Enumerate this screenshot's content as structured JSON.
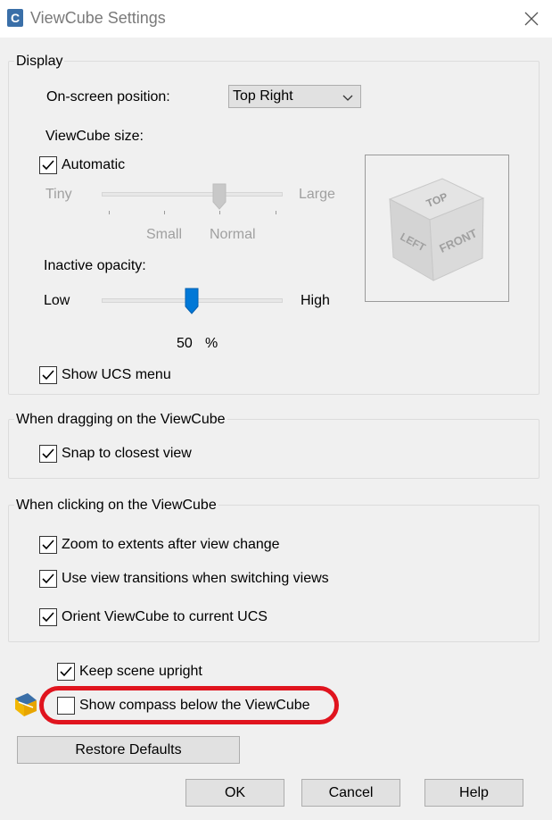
{
  "window": {
    "title": "ViewCube Settings",
    "app_icon": "autocad-icon",
    "close_icon": "close-icon"
  },
  "display": {
    "legend": "Display",
    "position_label": "On-screen position:",
    "position_value": "Top Right",
    "size_label": "ViewCube size:",
    "automatic_label": "Automatic",
    "automatic_checked": true,
    "size_tiny": "Tiny",
    "size_small": "Small",
    "size_normal": "Normal",
    "size_large": "Large",
    "size_selected": "Normal",
    "opacity_label": "Inactive opacity:",
    "opacity_low": "Low",
    "opacity_high": "High",
    "opacity_value": "50",
    "opacity_unit": "%",
    "show_ucs_label": "Show UCS menu",
    "show_ucs_checked": true,
    "cube_faces": {
      "top": "TOP",
      "left": "LEFT",
      "front": "FRONT"
    }
  },
  "dragging": {
    "legend": "When dragging on the ViewCube",
    "snap_label": "Snap to closest view",
    "snap_checked": true
  },
  "clicking": {
    "legend": "When clicking on the ViewCube",
    "zoom_label": "Zoom to extents after view change",
    "zoom_checked": true,
    "transitions_label": "Use view transitions when switching views",
    "transitions_checked": true,
    "orient_label": "Orient ViewCube to current UCS",
    "orient_checked": true
  },
  "misc": {
    "upright_label": "Keep scene upright",
    "upright_checked": true,
    "compass_label": "Show compass below the ViewCube",
    "compass_checked": false,
    "compass_icon": "compass-icon"
  },
  "buttons": {
    "restore": "Restore Defaults",
    "ok": "OK",
    "cancel": "Cancel",
    "help": "Help"
  },
  "colors": {
    "slider_thumb": "#0078d7",
    "highlight": "#e0141e"
  }
}
